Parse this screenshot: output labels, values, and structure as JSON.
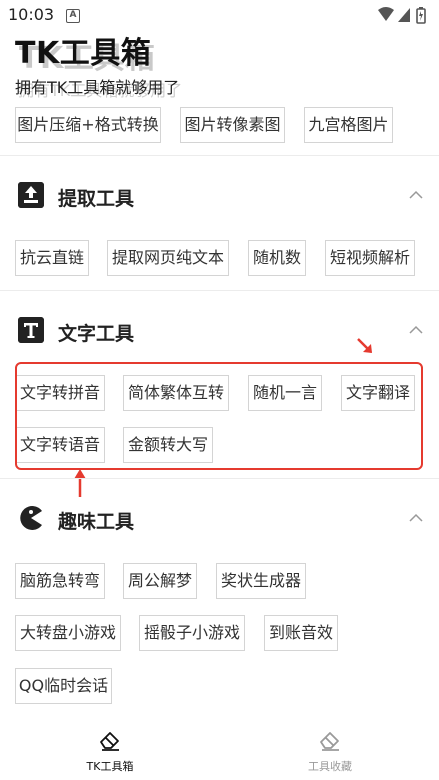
{
  "status_bar": {
    "time": "10:03",
    "notification_glyph": "A"
  },
  "header": {
    "title": "TK工具箱",
    "subtitle": "拥有TK工具箱就够用了"
  },
  "top_tools": [
    "图片压缩+格式转换",
    "图片转像素图",
    "九宫格图片"
  ],
  "sections": [
    {
      "title": "提取工具",
      "icon": "upload-box-icon",
      "items": [
        "抗云直链",
        "提取网页纯文本",
        "随机数",
        "短视频解析"
      ]
    },
    {
      "title": "文字工具",
      "icon": "text-t-icon",
      "items": [
        "文字转拼音",
        "简体繁体互转",
        "随机一言",
        "文字翻译",
        "文字转语音",
        "金额转大写"
      ]
    },
    {
      "title": "趣味工具",
      "icon": "pacman-icon",
      "items": [
        "脑筋急转弯",
        "周公解梦",
        "奖状生成器",
        "大转盘小游戏",
        "摇骰子小游戏",
        "到账音效",
        "QQ临时会话"
      ]
    }
  ],
  "bottom_nav": [
    {
      "label": "TK工具箱",
      "icon": "eraser-icon",
      "active": true
    },
    {
      "label": "工具收藏",
      "icon": "eraser-icon",
      "active": false
    }
  ],
  "colors": {
    "annotation_red": "#e53a2f",
    "active_nav": "#111111",
    "inactive_nav": "#9a9a9a"
  }
}
